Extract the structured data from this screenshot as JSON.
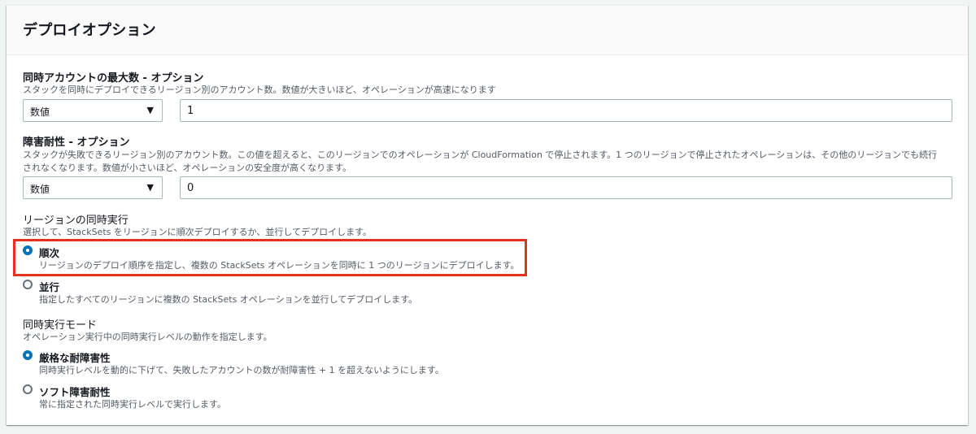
{
  "panel": {
    "title": "デプロイオプション"
  },
  "max_concurrent": {
    "label": "同時アカウントの最大数 - オプション",
    "description": "スタックを同時にデプロイできるリージョン別のアカウント数。数値が大きいほど、オペレーションが高速になります",
    "type_select": "数値",
    "value": "1"
  },
  "failure_tolerance": {
    "label": "障害耐性 - オプション",
    "description_line1": "スタックが失敗できるリージョン別のアカウント数。この値を超えると、このリージョンでのオペレーションが CloudFormation で停止されます。1 つのリージョンで停止されたオペレーションは、その他のリージョンでも続行",
    "description_line2": "されなくなります。数値が小さいほど、オペレーションの安全度が高くなります。",
    "type_select": "数値",
    "value": "0"
  },
  "region_concurrency": {
    "label": "リージョンの同時実行",
    "description": "選択して、StackSets をリージョンに順次デプロイするか、並行してデプロイします。",
    "options": [
      {
        "label": "順次",
        "description": "リージョンのデプロイ順序を指定し、複数の StackSets オペレーションを同時に 1 つのリージョンにデプロイします。",
        "selected": true
      },
      {
        "label": "並行",
        "description": "指定したすべてのリージョンに複数の StackSets オペレーションを並行してデプロイします。",
        "selected": false
      }
    ]
  },
  "concurrency_mode": {
    "label": "同時実行モード",
    "description": "オペレーション実行中の同時実行レベルの動作を指定します。",
    "options": [
      {
        "label": "厳格な耐障害性",
        "description": "同時実行レベルを動的に下げて、失敗したアカウントの数が耐障害性 + 1 を超えないようにします。",
        "selected": true
      },
      {
        "label": "ソフト障害耐性",
        "description": "常に指定された同時実行レベルで実行します。",
        "selected": false
      }
    ]
  },
  "colors": {
    "accent": "#0073bb",
    "highlight": "#e3321e",
    "muted_text": "#545b64"
  },
  "icons": {
    "select_caret": "caret-down-icon"
  }
}
